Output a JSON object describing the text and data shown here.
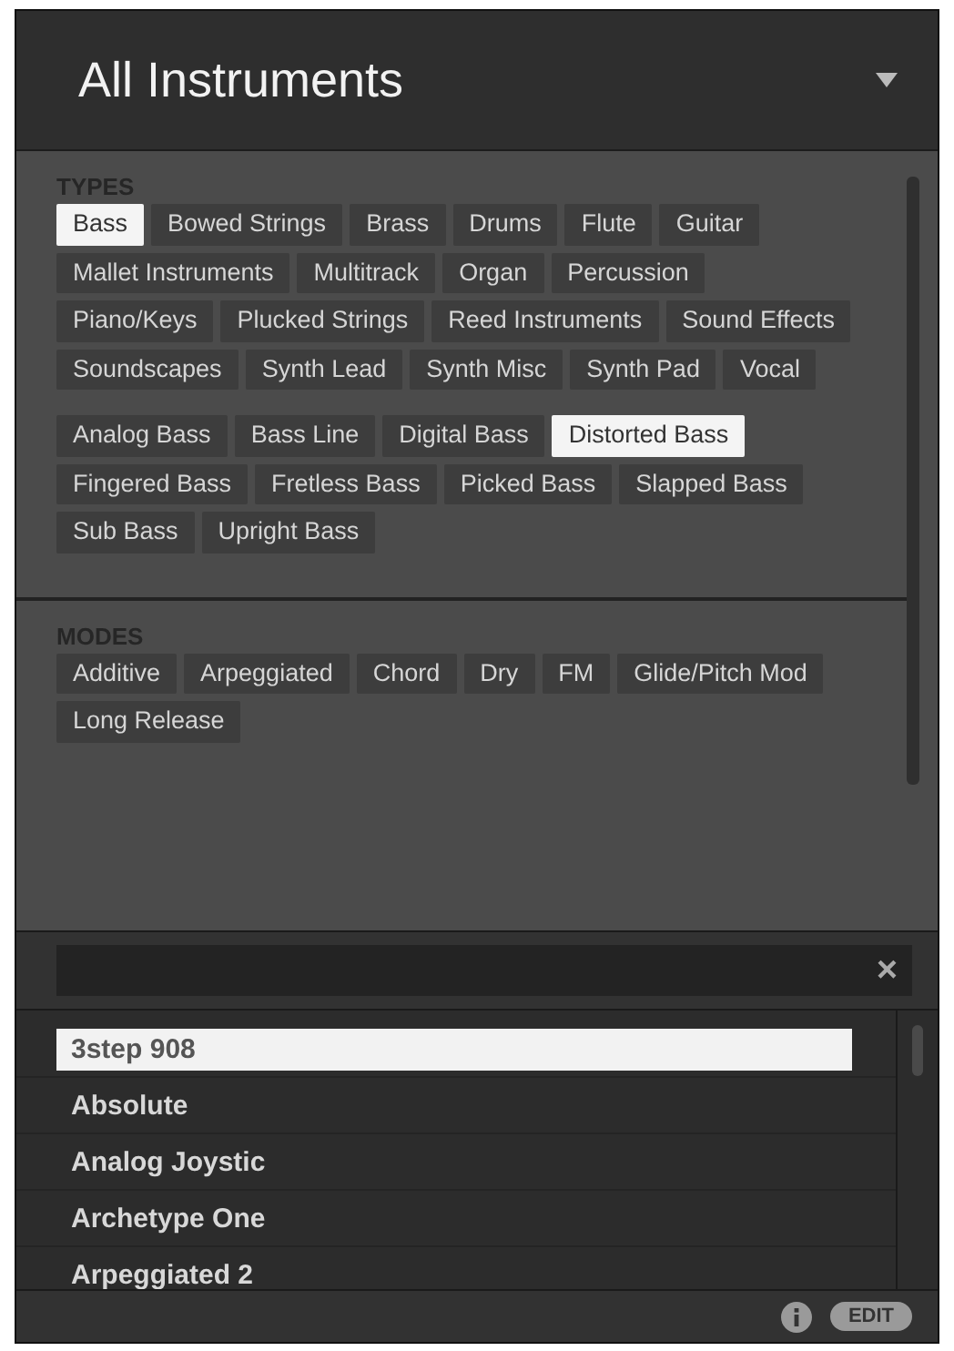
{
  "header": {
    "title": "All Instruments"
  },
  "sections": [
    {
      "label": "TYPES",
      "groups": [
        [
          {
            "label": "Bass",
            "selected": true
          },
          {
            "label": "Bowed Strings",
            "selected": false
          },
          {
            "label": "Brass",
            "selected": false
          },
          {
            "label": "Drums",
            "selected": false
          },
          {
            "label": "Flute",
            "selected": false
          },
          {
            "label": "Guitar",
            "selected": false
          },
          {
            "label": "Mallet Instruments",
            "selected": false
          },
          {
            "label": "Multitrack",
            "selected": false
          },
          {
            "label": "Organ",
            "selected": false
          },
          {
            "label": "Percussion",
            "selected": false
          },
          {
            "label": "Piano/Keys",
            "selected": false
          },
          {
            "label": "Plucked Strings",
            "selected": false
          },
          {
            "label": "Reed Instruments",
            "selected": false
          },
          {
            "label": "Sound Effects",
            "selected": false
          },
          {
            "label": "Soundscapes",
            "selected": false
          },
          {
            "label": "Synth Lead",
            "selected": false
          },
          {
            "label": "Synth Misc",
            "selected": false
          },
          {
            "label": "Synth Pad",
            "selected": false
          },
          {
            "label": "Vocal",
            "selected": false
          }
        ],
        [
          {
            "label": "Analog Bass",
            "selected": false
          },
          {
            "label": "Bass Line",
            "selected": false
          },
          {
            "label": "Digital Bass",
            "selected": false
          },
          {
            "label": "Distorted Bass",
            "selected": true
          },
          {
            "label": "Fingered Bass",
            "selected": false
          },
          {
            "label": "Fretless Bass",
            "selected": false
          },
          {
            "label": "Picked Bass",
            "selected": false
          },
          {
            "label": "Slapped Bass",
            "selected": false
          },
          {
            "label": "Sub Bass",
            "selected": false
          },
          {
            "label": "Upright Bass",
            "selected": false
          }
        ]
      ]
    },
    {
      "label": "MODES",
      "groups": [
        [
          {
            "label": "Additive",
            "selected": false
          },
          {
            "label": "Arpeggiated",
            "selected": false
          },
          {
            "label": "Chord",
            "selected": false
          },
          {
            "label": "Dry",
            "selected": false
          },
          {
            "label": "FM",
            "selected": false
          },
          {
            "label": "Glide/Pitch Mod",
            "selected": false
          },
          {
            "label": "Long Release",
            "selected": false
          }
        ]
      ]
    }
  ],
  "search": {
    "clear": "×"
  },
  "results": [
    {
      "name": "3step 908",
      "selected": true
    },
    {
      "name": "Absolute",
      "selected": false
    },
    {
      "name": "Analog Joystic",
      "selected": false
    },
    {
      "name": "Archetype One",
      "selected": false
    },
    {
      "name": "Arpeggiated 2",
      "selected": false
    }
  ],
  "footer": {
    "edit": "EDIT"
  }
}
